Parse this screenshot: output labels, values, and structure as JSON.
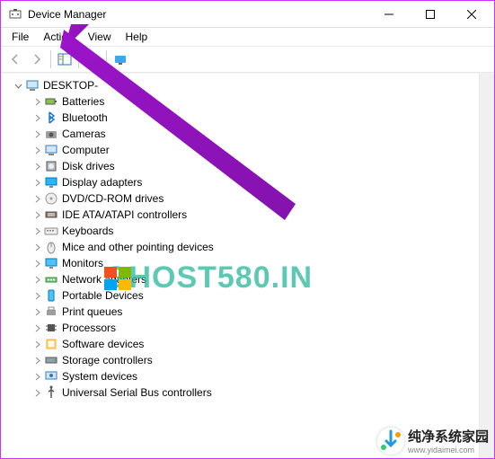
{
  "window": {
    "title": "Device Manager"
  },
  "menu": {
    "file": "File",
    "action": "Action",
    "view": "View",
    "help": "Help"
  },
  "tree": {
    "root": "DESKTOP-",
    "nodes": [
      {
        "label": "Batteries",
        "icon": "battery"
      },
      {
        "label": "Bluetooth",
        "icon": "bluetooth"
      },
      {
        "label": "Cameras",
        "icon": "camera"
      },
      {
        "label": "Computer",
        "icon": "computer"
      },
      {
        "label": "Disk drives",
        "icon": "disk"
      },
      {
        "label": "Display adapters",
        "icon": "display"
      },
      {
        "label": "DVD/CD-ROM drives",
        "icon": "dvd"
      },
      {
        "label": "IDE ATA/ATAPI controllers",
        "icon": "ide"
      },
      {
        "label": "Keyboards",
        "icon": "keyboard"
      },
      {
        "label": "Mice and other pointing devices",
        "icon": "mouse"
      },
      {
        "label": "Monitors",
        "icon": "monitor"
      },
      {
        "label": "Network adapters",
        "icon": "network"
      },
      {
        "label": "Portable Devices",
        "icon": "portable"
      },
      {
        "label": "Print queues",
        "icon": "printer"
      },
      {
        "label": "Processors",
        "icon": "cpu"
      },
      {
        "label": "Software devices",
        "icon": "software"
      },
      {
        "label": "Storage controllers",
        "icon": "storage"
      },
      {
        "label": "System devices",
        "icon": "system"
      },
      {
        "label": "Universal Serial Bus controllers",
        "icon": "usb"
      }
    ]
  },
  "watermark": {
    "text": "GHOST580.IN"
  },
  "footer": {
    "cn": "纯净系统家园",
    "url": "www.yidaimei.com"
  }
}
